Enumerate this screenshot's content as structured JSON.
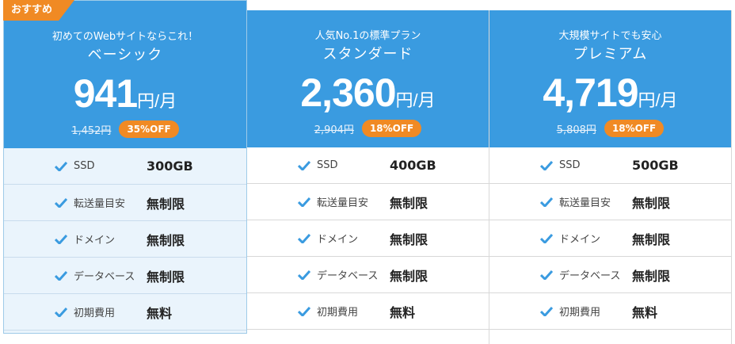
{
  "ribbon_label": "おすすめ",
  "colors": {
    "header": "#3a9be0",
    "accent": "#f08a24",
    "check": "#3a9be0"
  },
  "plans": [
    {
      "tagline": "初めてのWebサイトならこれ！",
      "name": "ベーシック",
      "price": "941",
      "unit": "円/月",
      "old_price": "1,452円",
      "discount": "35%OFF",
      "features": [
        {
          "label": "SSD",
          "value": "300GB"
        },
        {
          "label": "転送量目安",
          "value": "無制限"
        },
        {
          "label": "ドメイン",
          "value": "無制限"
        },
        {
          "label": "データベース",
          "value": "無制限"
        },
        {
          "label": "初期費用",
          "value": "無料"
        }
      ]
    },
    {
      "tagline": "人気No.1の標準プラン",
      "name": "スタンダード",
      "price": "2,360",
      "unit": "円/月",
      "old_price": "2,904円",
      "discount": "18%OFF",
      "features": [
        {
          "label": "SSD",
          "value": "400GB"
        },
        {
          "label": "転送量目安",
          "value": "無制限"
        },
        {
          "label": "ドメイン",
          "value": "無制限"
        },
        {
          "label": "データベース",
          "value": "無制限"
        },
        {
          "label": "初期費用",
          "value": "無料"
        }
      ]
    },
    {
      "tagline": "大規模サイトでも安心",
      "name": "プレミアム",
      "price": "4,719",
      "unit": "円/月",
      "old_price": "5,808円",
      "discount": "18%OFF",
      "features": [
        {
          "label": "SSD",
          "value": "500GB"
        },
        {
          "label": "転送量目安",
          "value": "無制限"
        },
        {
          "label": "ドメイン",
          "value": "無制限"
        },
        {
          "label": "データベース",
          "value": "無制限"
        },
        {
          "label": "初期費用",
          "value": "無料"
        }
      ]
    }
  ]
}
